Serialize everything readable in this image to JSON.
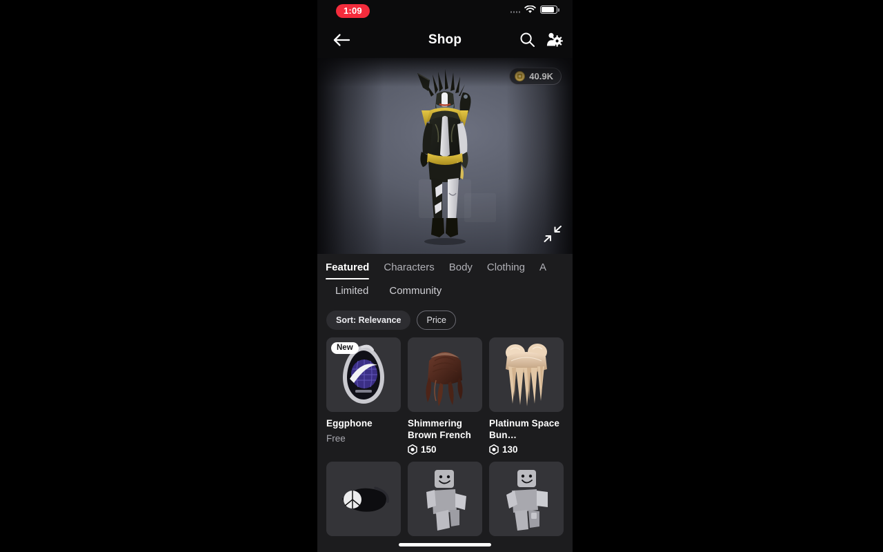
{
  "status_bar": {
    "recording_time": "1:09",
    "signal_icon": "signal-dots-icon",
    "wifi_icon": "wifi-icon",
    "battery_icon": "battery-icon"
  },
  "nav": {
    "back_icon": "arrow-left-icon",
    "title": "Shop",
    "search_icon": "search-icon",
    "avatar_editor_icon": "avatar-gear-icon"
  },
  "preview": {
    "currency_icon": "robux-coin-icon",
    "currency_amount": "40.9K",
    "collapse_icon": "collapse-arrows-icon"
  },
  "tabs": {
    "primary": [
      {
        "label": "Featured",
        "active": true
      },
      {
        "label": "Characters",
        "active": false
      },
      {
        "label": "Body",
        "active": false
      },
      {
        "label": "Clothing",
        "active": false
      },
      {
        "label": "A",
        "active": false
      }
    ],
    "secondary": [
      {
        "label": "Limited"
      },
      {
        "label": "Community"
      }
    ]
  },
  "filters": [
    {
      "label": "Sort: Relevance",
      "style": "filled"
    },
    {
      "label": "Price",
      "style": "outline"
    }
  ],
  "items": [
    {
      "name": "Eggphone",
      "price": "Free",
      "price_type": "free",
      "badge": "New",
      "thumb_icon": "eggphone-thumb"
    },
    {
      "name": "Shimmering Brown French",
      "price": "150",
      "price_type": "robux",
      "badge": "",
      "thumb_icon": "brown-braid-hair-thumb"
    },
    {
      "name": "Platinum Space Bun…",
      "price": "130",
      "price_type": "robux",
      "badge": "",
      "thumb_icon": "platinum-space-bun-hair-thumb"
    },
    {
      "name": "",
      "price": "",
      "price_type": "none",
      "badge": "",
      "thumb_icon": "black-eye-mask-thumb"
    },
    {
      "name": "",
      "price": "",
      "price_type": "none",
      "badge": "",
      "thumb_icon": "avatar-bundle-thumb-1"
    },
    {
      "name": "",
      "price": "",
      "price_type": "none",
      "badge": "",
      "thumb_icon": "avatar-bundle-thumb-2"
    }
  ],
  "colors": {
    "screen_bg": "#1c1c1e",
    "bar_bg": "#0b0b0c",
    "card_bg": "#343438",
    "accent_record": "#f42c3c",
    "coin_gold": "#c8a24e",
    "text_primary": "#ffffff",
    "text_muted": "#a9a9b0"
  },
  "home_indicator": "home-indicator"
}
